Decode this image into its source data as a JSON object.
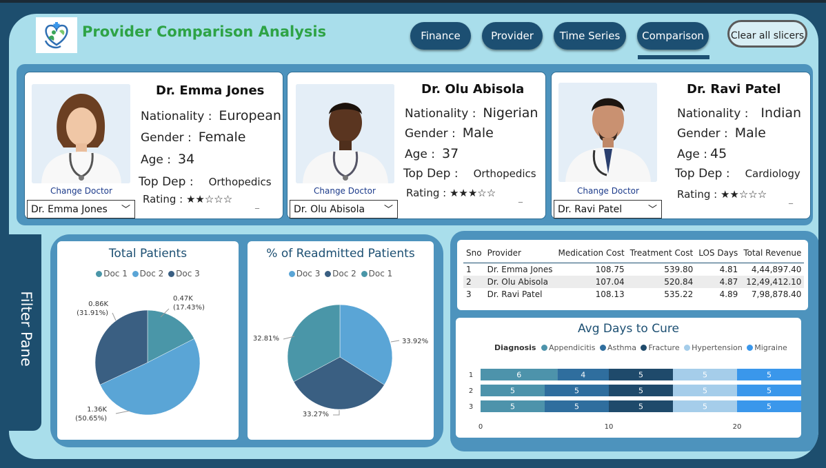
{
  "header": {
    "title": "Provider Comparison Analysis",
    "nav": [
      "Finance",
      "Provider",
      "Time Series",
      "Comparison"
    ],
    "active_nav": "Comparison",
    "clear_label": "Clear all slicers"
  },
  "doctors": [
    {
      "name": "Dr. Emma Jones",
      "nationality_label": "Nationality :",
      "nationality": "European",
      "gender_label": "Gender :",
      "gender": "Female",
      "age_label": "Age :",
      "age": "34",
      "topdep_label": "Top Dep :",
      "topdep": "Orthopedics",
      "rating_label": "Rating :",
      "stars": "★★☆☆☆",
      "rating": 2,
      "change_label": "Change Doctor",
      "selected": "Dr. Emma Jones"
    },
    {
      "name": "Dr. Olu Abisola",
      "nationality_label": "Nationality :",
      "nationality": "Nigerian",
      "gender_label": "Gender :",
      "gender": "Male",
      "age_label": "Age :",
      "age": "37",
      "topdep_label": "Top Dep :",
      "topdep": "Orthopedics",
      "rating_label": "Rating :",
      "stars": "★★★☆☆",
      "rating": 3,
      "change_label": "Change Doctor",
      "selected": "Dr. Olu Abisola"
    },
    {
      "name": "Dr. Ravi Patel",
      "nationality_label": "Nationality :",
      "nationality": "Indian",
      "gender_label": "Gender :",
      "gender": "Male",
      "age_label": "Age :",
      "age": "45",
      "topdep_label": "Top Dep :",
      "topdep": "Cardiology",
      "rating_label": "Rating :",
      "stars": "★★☆☆☆",
      "rating": 2,
      "change_label": "Change Doctor",
      "selected": "Dr. Ravi Patel"
    }
  ],
  "filter_pane": "Filter Pane",
  "colors": {
    "doc1": "#4a96a8",
    "doc2": "#5aa5d6",
    "doc3": "#3a5f82",
    "appendicitis": "#4d93ab",
    "asthma": "#2f6e9e",
    "fracture": "#1f4a6b",
    "hypertension": "#a5cdea",
    "migraine": "#3a97eb"
  },
  "total_patients": {
    "title": "Total Patients",
    "legend": [
      "Doc 1",
      "Doc 2",
      "Doc 3"
    ],
    "labels": [
      {
        "name": "Doc 1",
        "value": "0.47K",
        "pct": "(17.43%)"
      },
      {
        "name": "Doc 2",
        "value": "1.36K",
        "pct": "(50.65%)"
      },
      {
        "name": "Doc 3",
        "value": "0.86K",
        "pct": "(31.91%)"
      }
    ]
  },
  "readmitted": {
    "title": "% of Readmitted Patients",
    "legend": [
      "Doc 3",
      "Doc 2",
      "Doc 1"
    ],
    "labels": [
      {
        "name": "Doc 2",
        "pct": "33.92%"
      },
      {
        "name": "Doc 3",
        "pct": "33.27%"
      },
      {
        "name": "Doc 1",
        "pct": "32.81%"
      }
    ]
  },
  "table": {
    "headers": [
      "Sno",
      "Provider",
      "Medication Cost",
      "Treatment Cost",
      "LOS Days",
      "Total Revenue"
    ],
    "rows": [
      [
        "1",
        "Dr. Emma Jones",
        "108.75",
        "539.80",
        "4.81",
        "4,44,897.40"
      ],
      [
        "2",
        "Dr. Olu Abisola",
        "107.04",
        "520.84",
        "4.87",
        "12,49,412.10"
      ],
      [
        "3",
        "Dr. Ravi Patel",
        "108.13",
        "535.22",
        "4.89",
        "7,98,878.40"
      ]
    ]
  },
  "avg_days": {
    "title": "Avg Days to Cure",
    "legend_title": "Diagnosis",
    "diagnoses": [
      "Appendicitis",
      "Asthma",
      "Fracture",
      "Hypertension",
      "Migraine"
    ],
    "categories": [
      "1",
      "2",
      "3"
    ],
    "x_ticks": [
      "0",
      "10",
      "20"
    ]
  },
  "chart_data": [
    {
      "type": "pie",
      "title": "Total Patients",
      "categories": [
        "Doc 1",
        "Doc 2",
        "Doc 3"
      ],
      "values": [
        0.47,
        1.36,
        0.86
      ],
      "percentages": [
        17.43,
        50.65,
        31.91
      ],
      "legend": "top"
    },
    {
      "type": "pie",
      "title": "% of Readmitted Patients",
      "categories": [
        "Doc 1",
        "Doc 2",
        "Doc 3"
      ],
      "values": [
        32.81,
        33.92,
        33.27
      ],
      "legend": "top"
    },
    {
      "type": "bar",
      "orientation": "horizontal",
      "stacked": true,
      "title": "Avg Days to Cure",
      "categories": [
        "1",
        "2",
        "3"
      ],
      "series": [
        {
          "name": "Appendicitis",
          "values": [
            6,
            5,
            5
          ]
        },
        {
          "name": "Asthma",
          "values": [
            4,
            5,
            5
          ]
        },
        {
          "name": "Fracture",
          "values": [
            5,
            5,
            5
          ]
        },
        {
          "name": "Hypertension",
          "values": [
            5,
            5,
            5
          ]
        },
        {
          "name": "Migraine",
          "values": [
            5,
            5,
            5
          ]
        }
      ],
      "xlim": [
        0,
        25
      ],
      "legend": "top"
    }
  ]
}
